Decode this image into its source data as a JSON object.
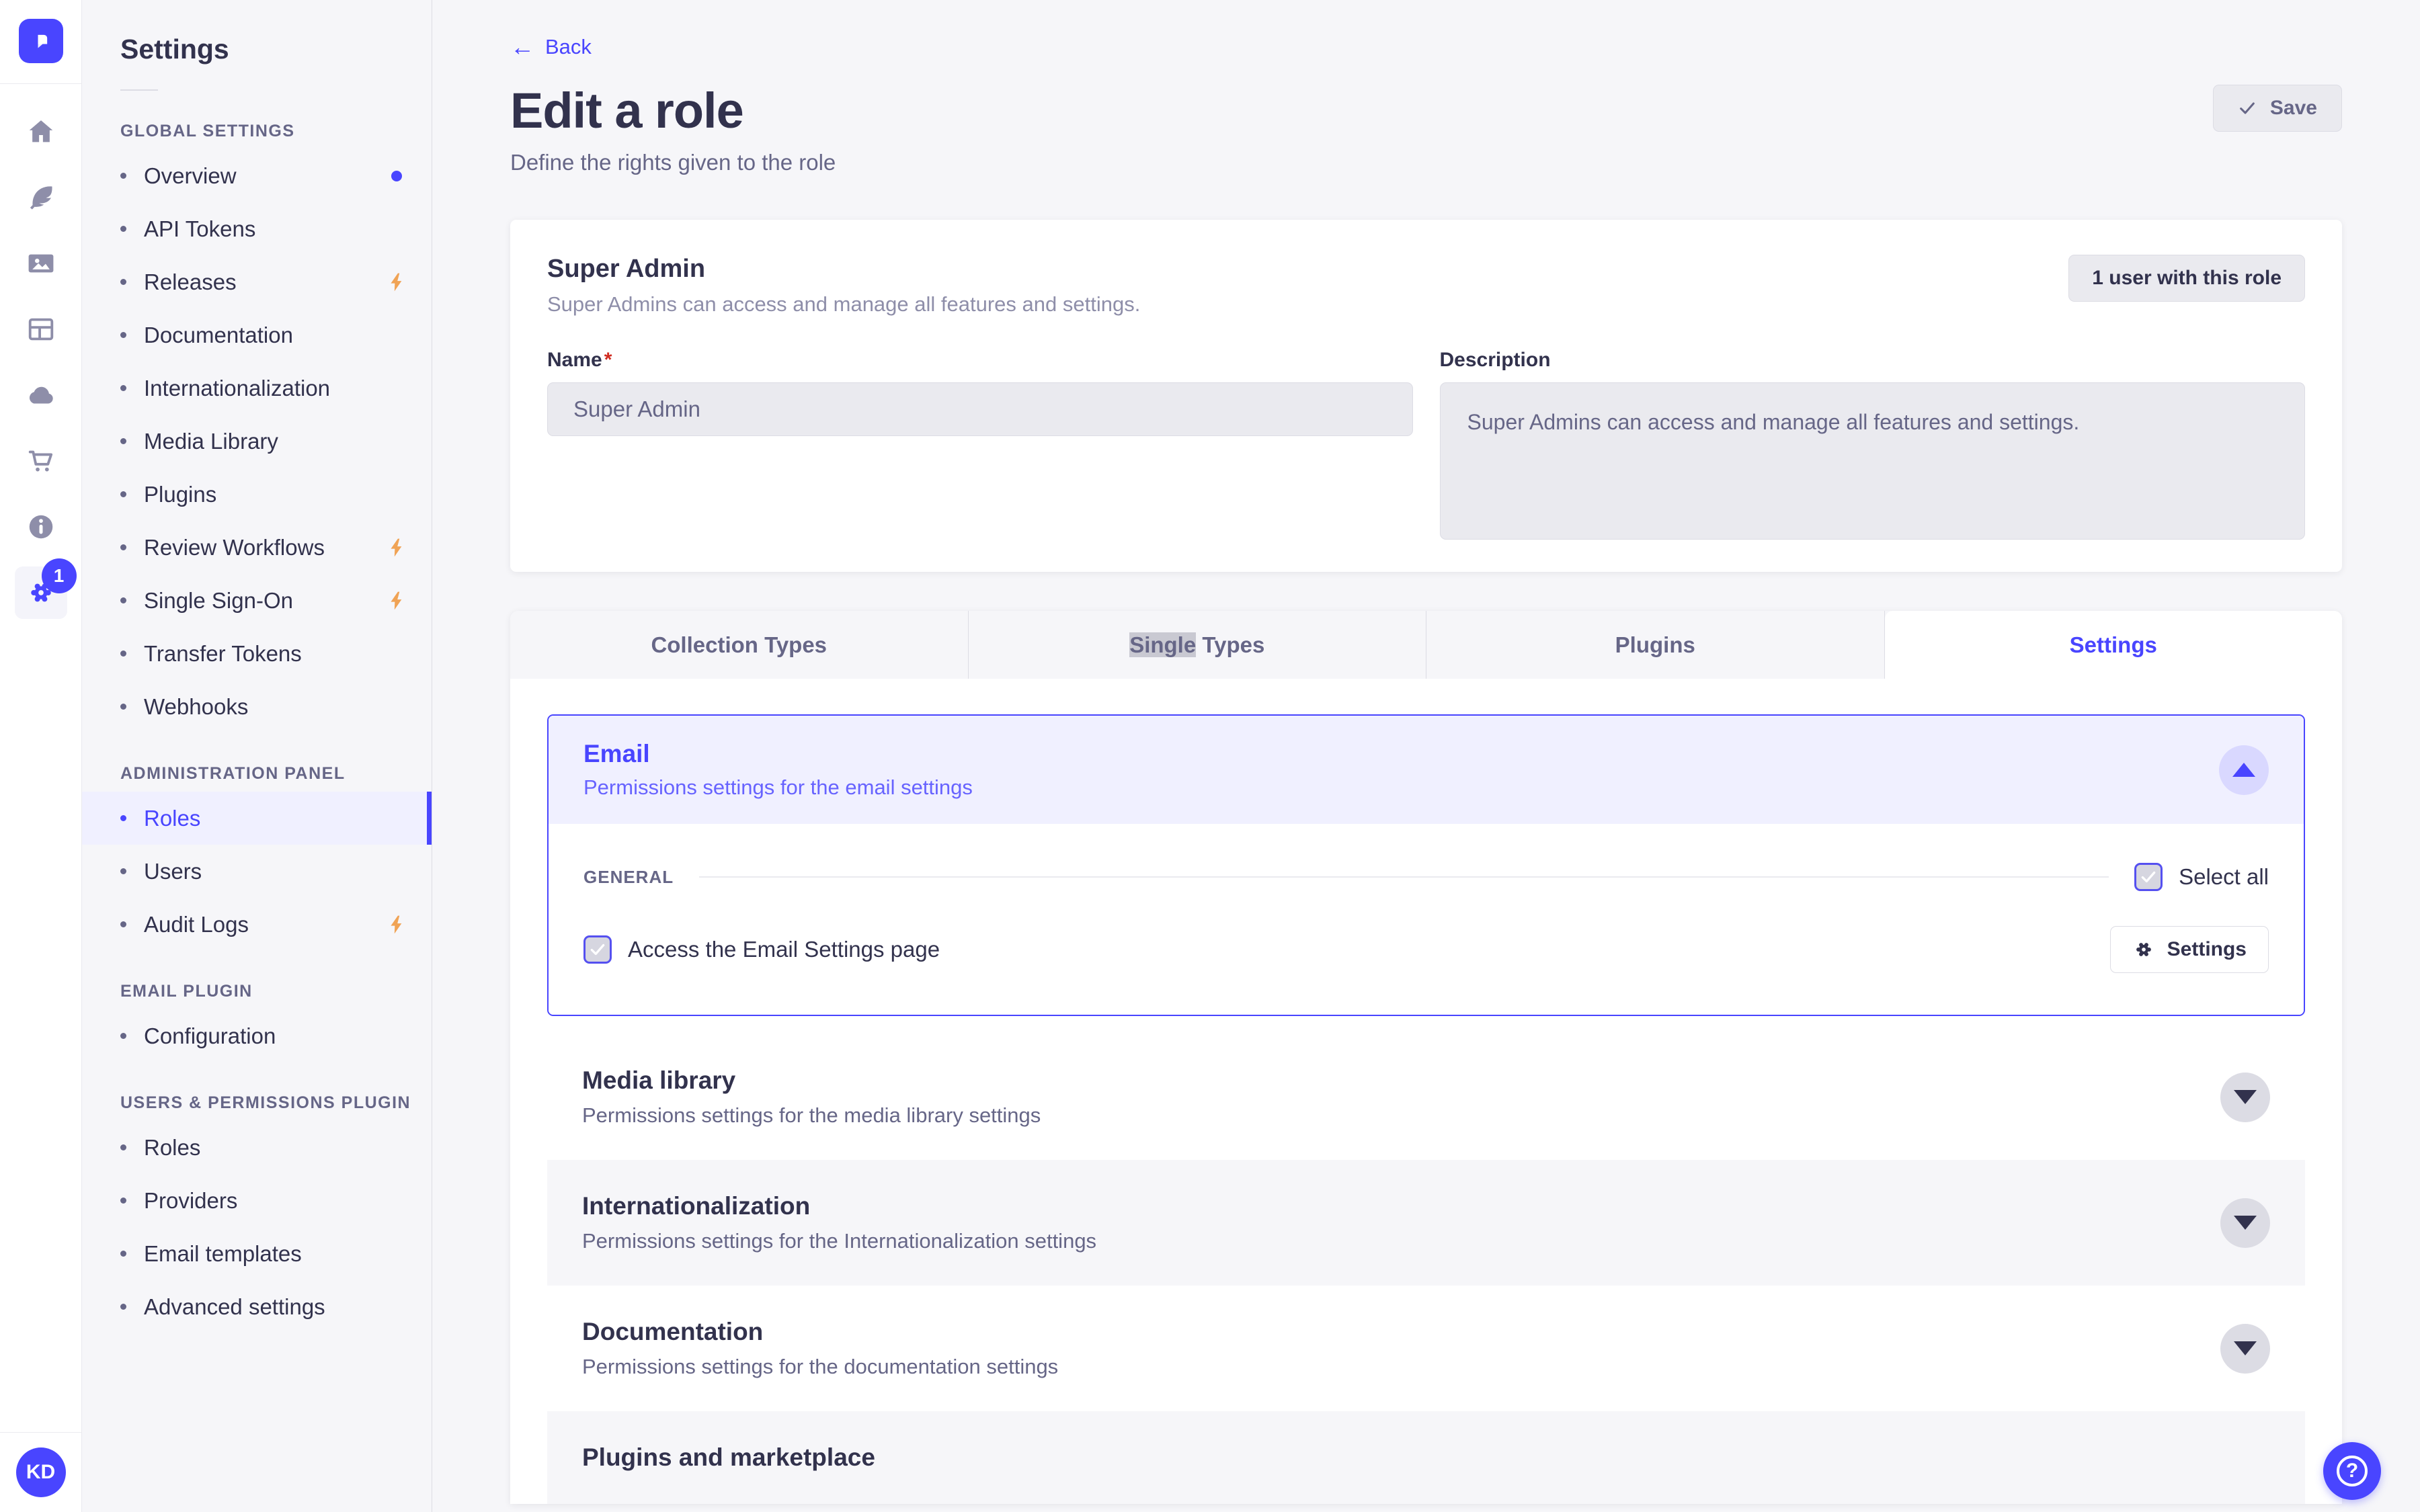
{
  "colors": {
    "accent": "#4945ff",
    "accent_light": "#f0f0ff",
    "lightning": "#f0a355",
    "required_star": "#d02b20",
    "text_dark": "#32324d",
    "text_muted": "#666687"
  },
  "rail": {
    "settings_badge": "1",
    "avatar": "KD"
  },
  "sidebar": {
    "title": "Settings",
    "sections": [
      {
        "label": "GLOBAL SETTINGS",
        "items": [
          {
            "label": "Overview"
          },
          {
            "label": "API Tokens"
          },
          {
            "label": "Releases"
          },
          {
            "label": "Documentation"
          },
          {
            "label": "Internationalization"
          },
          {
            "label": "Media Library"
          },
          {
            "label": "Plugins"
          },
          {
            "label": "Review Workflows"
          },
          {
            "label": "Single Sign-On"
          },
          {
            "label": "Transfer Tokens"
          },
          {
            "label": "Webhooks"
          }
        ]
      },
      {
        "label": "ADMINISTRATION PANEL",
        "items": [
          {
            "label": "Roles"
          },
          {
            "label": "Users"
          },
          {
            "label": "Audit Logs"
          }
        ]
      },
      {
        "label": "EMAIL PLUGIN",
        "items": [
          {
            "label": "Configuration"
          }
        ]
      },
      {
        "label": "USERS & PERMISSIONS PLUGIN",
        "items": [
          {
            "label": "Roles"
          },
          {
            "label": "Providers"
          },
          {
            "label": "Email templates"
          },
          {
            "label": "Advanced settings"
          }
        ]
      }
    ]
  },
  "header": {
    "back": "Back",
    "title": "Edit a role",
    "subtitle": "Define the rights given to the role",
    "save": "Save"
  },
  "role_card": {
    "title": "Super Admin",
    "subtitle": "Super Admins can access and manage all features and settings.",
    "users_button": "1 user with this role",
    "name_label": "Name",
    "name_required": "*",
    "name_value": "Super Admin",
    "description_label": "Description",
    "description_value": "Super Admins can access and manage all features and settings."
  },
  "tabs": [
    {
      "label": "Collection Types"
    },
    {
      "hl": "Single",
      "rest": " Types"
    },
    {
      "label": "Plugins"
    },
    {
      "label": "Settings"
    }
  ],
  "permissions": {
    "email": {
      "title": "Email",
      "subtitle": "Permissions settings for the email settings",
      "section": "GENERAL",
      "select_all": "Select all",
      "checkbox_label": "Access the Email Settings page",
      "settings_button": "Settings"
    },
    "collapsed": [
      {
        "title": "Media library",
        "subtitle": "Permissions settings for the media library settings"
      },
      {
        "title": "Internationalization",
        "subtitle": "Permissions settings for the Internationalization settings"
      },
      {
        "title": "Documentation",
        "subtitle": "Permissions settings for the documentation settings"
      },
      {
        "title": "Plugins and marketplace",
        "subtitle": ""
      }
    ]
  },
  "help": {
    "icon": "?"
  }
}
